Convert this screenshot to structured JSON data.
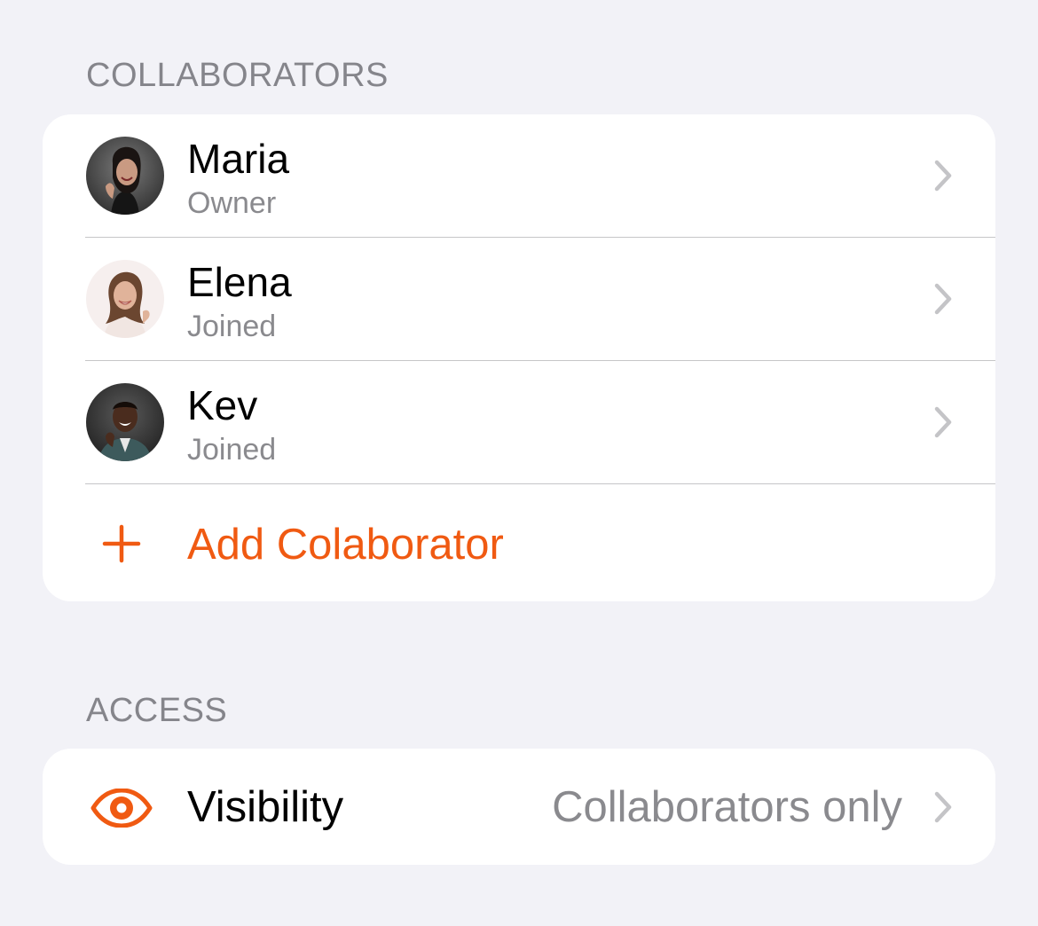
{
  "colors": {
    "accent": "#f05a12",
    "background": "#f2f2f7",
    "card": "#ffffff",
    "secondary_text": "#8a8a8e",
    "chevron": "#c4c4c7"
  },
  "collaborators_section": {
    "header": "COLLABORATORS",
    "people": [
      {
        "name": "Maria",
        "role": "Owner",
        "avatar_icon": "avatar-photo-maria",
        "chevron_icon": "chevron-right-icon"
      },
      {
        "name": "Elena",
        "role": "Joined",
        "avatar_icon": "avatar-photo-elena",
        "chevron_icon": "chevron-right-icon"
      },
      {
        "name": "Kev",
        "role": "Joined",
        "avatar_icon": "avatar-photo-kev",
        "chevron_icon": "chevron-right-icon"
      }
    ],
    "add_action": {
      "label": "Add Colaborator",
      "icon": "plus-icon"
    }
  },
  "access_section": {
    "header": "ACCESS",
    "visibility": {
      "label": "Visibility",
      "value": "Collaborators only",
      "icon": "eye-icon",
      "chevron_icon": "chevron-right-icon"
    }
  }
}
